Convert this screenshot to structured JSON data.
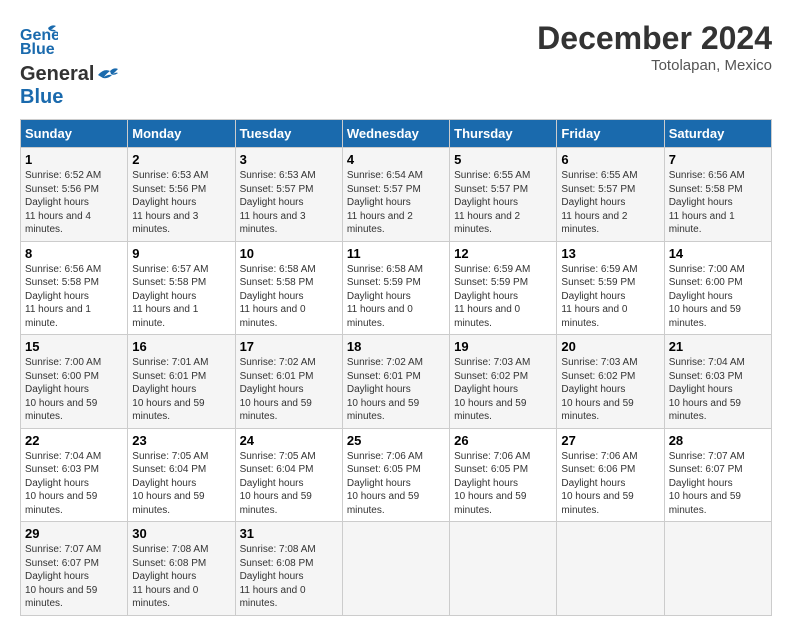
{
  "header": {
    "logo_line1": "General",
    "logo_line2": "Blue",
    "month": "December 2024",
    "location": "Totolapan, Mexico"
  },
  "weekdays": [
    "Sunday",
    "Monday",
    "Tuesday",
    "Wednesday",
    "Thursday",
    "Friday",
    "Saturday"
  ],
  "weeks": [
    [
      {
        "day": 1,
        "sunrise": "6:52 AM",
        "sunset": "5:56 PM",
        "daylight": "11 hours and 4 minutes."
      },
      {
        "day": 2,
        "sunrise": "6:53 AM",
        "sunset": "5:56 PM",
        "daylight": "11 hours and 3 minutes."
      },
      {
        "day": 3,
        "sunrise": "6:53 AM",
        "sunset": "5:57 PM",
        "daylight": "11 hours and 3 minutes."
      },
      {
        "day": 4,
        "sunrise": "6:54 AM",
        "sunset": "5:57 PM",
        "daylight": "11 hours and 2 minutes."
      },
      {
        "day": 5,
        "sunrise": "6:55 AM",
        "sunset": "5:57 PM",
        "daylight": "11 hours and 2 minutes."
      },
      {
        "day": 6,
        "sunrise": "6:55 AM",
        "sunset": "5:57 PM",
        "daylight": "11 hours and 2 minutes."
      },
      {
        "day": 7,
        "sunrise": "6:56 AM",
        "sunset": "5:58 PM",
        "daylight": "11 hours and 1 minute."
      }
    ],
    [
      {
        "day": 8,
        "sunrise": "6:56 AM",
        "sunset": "5:58 PM",
        "daylight": "11 hours and 1 minute."
      },
      {
        "day": 9,
        "sunrise": "6:57 AM",
        "sunset": "5:58 PM",
        "daylight": "11 hours and 1 minute."
      },
      {
        "day": 10,
        "sunrise": "6:58 AM",
        "sunset": "5:58 PM",
        "daylight": "11 hours and 0 minutes."
      },
      {
        "day": 11,
        "sunrise": "6:58 AM",
        "sunset": "5:59 PM",
        "daylight": "11 hours and 0 minutes."
      },
      {
        "day": 12,
        "sunrise": "6:59 AM",
        "sunset": "5:59 PM",
        "daylight": "11 hours and 0 minutes."
      },
      {
        "day": 13,
        "sunrise": "6:59 AM",
        "sunset": "5:59 PM",
        "daylight": "11 hours and 0 minutes."
      },
      {
        "day": 14,
        "sunrise": "7:00 AM",
        "sunset": "6:00 PM",
        "daylight": "10 hours and 59 minutes."
      }
    ],
    [
      {
        "day": 15,
        "sunrise": "7:00 AM",
        "sunset": "6:00 PM",
        "daylight": "10 hours and 59 minutes."
      },
      {
        "day": 16,
        "sunrise": "7:01 AM",
        "sunset": "6:01 PM",
        "daylight": "10 hours and 59 minutes."
      },
      {
        "day": 17,
        "sunrise": "7:02 AM",
        "sunset": "6:01 PM",
        "daylight": "10 hours and 59 minutes."
      },
      {
        "day": 18,
        "sunrise": "7:02 AM",
        "sunset": "6:01 PM",
        "daylight": "10 hours and 59 minutes."
      },
      {
        "day": 19,
        "sunrise": "7:03 AM",
        "sunset": "6:02 PM",
        "daylight": "10 hours and 59 minutes."
      },
      {
        "day": 20,
        "sunrise": "7:03 AM",
        "sunset": "6:02 PM",
        "daylight": "10 hours and 59 minutes."
      },
      {
        "day": 21,
        "sunrise": "7:04 AM",
        "sunset": "6:03 PM",
        "daylight": "10 hours and 59 minutes."
      }
    ],
    [
      {
        "day": 22,
        "sunrise": "7:04 AM",
        "sunset": "6:03 PM",
        "daylight": "10 hours and 59 minutes."
      },
      {
        "day": 23,
        "sunrise": "7:05 AM",
        "sunset": "6:04 PM",
        "daylight": "10 hours and 59 minutes."
      },
      {
        "day": 24,
        "sunrise": "7:05 AM",
        "sunset": "6:04 PM",
        "daylight": "10 hours and 59 minutes."
      },
      {
        "day": 25,
        "sunrise": "7:06 AM",
        "sunset": "6:05 PM",
        "daylight": "10 hours and 59 minutes."
      },
      {
        "day": 26,
        "sunrise": "7:06 AM",
        "sunset": "6:05 PM",
        "daylight": "10 hours and 59 minutes."
      },
      {
        "day": 27,
        "sunrise": "7:06 AM",
        "sunset": "6:06 PM",
        "daylight": "10 hours and 59 minutes."
      },
      {
        "day": 28,
        "sunrise": "7:07 AM",
        "sunset": "6:07 PM",
        "daylight": "10 hours and 59 minutes."
      }
    ],
    [
      {
        "day": 29,
        "sunrise": "7:07 AM",
        "sunset": "6:07 PM",
        "daylight": "10 hours and 59 minutes."
      },
      {
        "day": 30,
        "sunrise": "7:08 AM",
        "sunset": "6:08 PM",
        "daylight": "11 hours and 0 minutes."
      },
      {
        "day": 31,
        "sunrise": "7:08 AM",
        "sunset": "6:08 PM",
        "daylight": "11 hours and 0 minutes."
      },
      null,
      null,
      null,
      null
    ]
  ]
}
